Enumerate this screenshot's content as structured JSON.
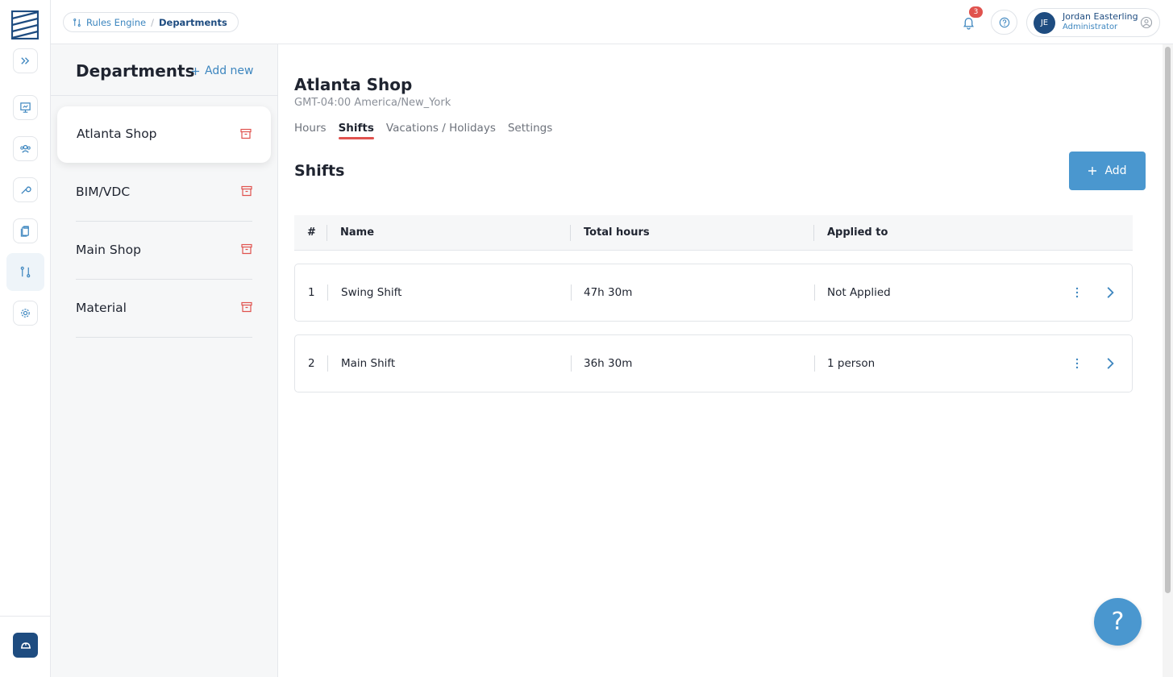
{
  "brand": {
    "logo_icon": "logo-icon"
  },
  "rail": {
    "items": [
      {
        "icon": "expand-icon"
      },
      {
        "icon": "presentation-icon"
      },
      {
        "icon": "team-icon"
      },
      {
        "icon": "wrench-icon"
      },
      {
        "icon": "clipboard-icon"
      },
      {
        "icon": "rules-icon",
        "active": true
      },
      {
        "icon": "gear-icon"
      }
    ],
    "bottom_icon": "hardhat-icon"
  },
  "header": {
    "breadcrumb": {
      "root": "Rules Engine",
      "separator": "/",
      "current": "Departments"
    },
    "notifications_count": "3",
    "user": {
      "initials": "JE",
      "name": "Jordan Easterling",
      "role": "Administrator"
    }
  },
  "departments": {
    "title": "Departments",
    "add_label": "Add new",
    "items": [
      {
        "label": "Atlanta Shop",
        "selected": true
      },
      {
        "label": "BIM/VDC"
      },
      {
        "label": "Main Shop"
      },
      {
        "label": "Material"
      }
    ]
  },
  "main": {
    "title": "Atlanta Shop",
    "timezone": "GMT-04:00 America/New_York",
    "tabs": [
      {
        "label": "Hours"
      },
      {
        "label": "Shifts",
        "active": true
      },
      {
        "label": "Vacations / Holidays"
      },
      {
        "label": "Settings"
      }
    ],
    "section_title": "Shifts",
    "add_label": "Add",
    "table": {
      "columns": [
        "#",
        "Name",
        "Total hours",
        "Applied to"
      ],
      "rows": [
        {
          "num": "1",
          "name": "Swing Shift",
          "total_hours": "47h 30m",
          "applied_to": "Not Applied"
        },
        {
          "num": "2",
          "name": "Main Shift",
          "total_hours": "36h 30m",
          "applied_to": "1 person"
        }
      ]
    }
  },
  "help_fab": "?",
  "colors": {
    "accent": "#4a97cf",
    "brand_dark": "#1e4c80",
    "danger": "#e0524e",
    "link": "#3d86bf"
  }
}
